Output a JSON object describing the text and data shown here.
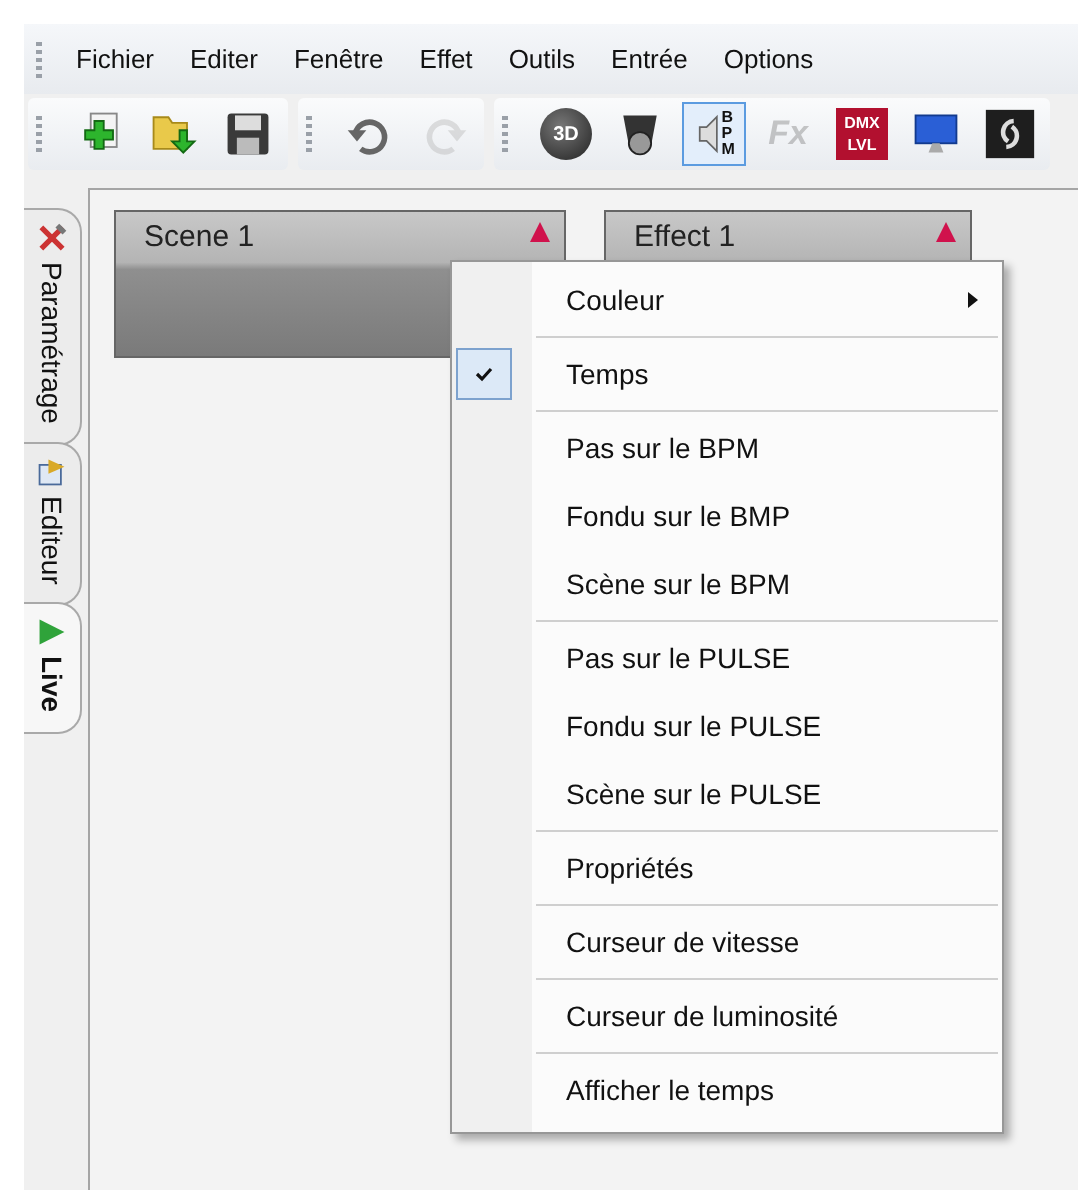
{
  "menubar": {
    "items": [
      "Fichier",
      "Editer",
      "Fenêtre",
      "Effet",
      "Outils",
      "Entrée",
      "Options"
    ]
  },
  "toolbar": {
    "groups": [
      [
        {
          "kind": "new",
          "disabled": false,
          "pressed": false
        },
        {
          "kind": "open",
          "disabled": false,
          "pressed": false
        },
        {
          "kind": "save",
          "disabled": false,
          "pressed": false
        }
      ],
      [
        {
          "kind": "undo",
          "disabled": false,
          "pressed": false
        },
        {
          "kind": "redo",
          "disabled": true,
          "pressed": false
        }
      ],
      [
        {
          "kind": "ball",
          "text": "3D",
          "disabled": false,
          "pressed": false
        },
        {
          "kind": "projector",
          "disabled": false,
          "pressed": false
        },
        {
          "kind": "bpm",
          "text": "BPM",
          "disabled": false,
          "pressed": true
        },
        {
          "kind": "fx",
          "text": "Fx",
          "disabled": true,
          "pressed": false
        },
        {
          "kind": "dmx",
          "text": "DMX LVL",
          "disabled": false,
          "pressed": false
        },
        {
          "kind": "monitor",
          "disabled": false,
          "pressed": false
        },
        {
          "kind": "logo",
          "disabled": false,
          "pressed": false
        }
      ]
    ]
  },
  "side_tabs": [
    {
      "label": "Paramétrage",
      "kind": "tools",
      "selected": false
    },
    {
      "label": "Editeur",
      "kind": "editor",
      "selected": false
    },
    {
      "label": "Live",
      "kind": "live",
      "selected": true
    }
  ],
  "cards": [
    {
      "label": "Scene 1"
    },
    {
      "label": "Effect 1"
    }
  ],
  "context_menu": {
    "groups": [
      [
        {
          "label": "Couleur",
          "checked": false,
          "submenu": true
        }
      ],
      [
        {
          "label": "Temps",
          "checked": true,
          "submenu": false
        }
      ],
      [
        {
          "label": "Pas sur le BPM",
          "checked": false,
          "submenu": false
        },
        {
          "label": "Fondu sur le BMP",
          "checked": false,
          "submenu": false
        },
        {
          "label": "Scène sur le BPM",
          "checked": false,
          "submenu": false
        }
      ],
      [
        {
          "label": "Pas sur le PULSE",
          "checked": false,
          "submenu": false
        },
        {
          "label": "Fondu sur le PULSE",
          "checked": false,
          "submenu": false
        },
        {
          "label": "Scène sur le PULSE",
          "checked": false,
          "submenu": false
        }
      ],
      [
        {
          "label": "Propriétés",
          "checked": false,
          "submenu": false
        }
      ],
      [
        {
          "label": "Curseur de vitesse",
          "checked": false,
          "submenu": false
        }
      ],
      [
        {
          "label": "Curseur de luminosité",
          "checked": false,
          "submenu": false
        }
      ],
      [
        {
          "label": "Afficher le temps",
          "checked": false,
          "submenu": false
        }
      ]
    ]
  }
}
